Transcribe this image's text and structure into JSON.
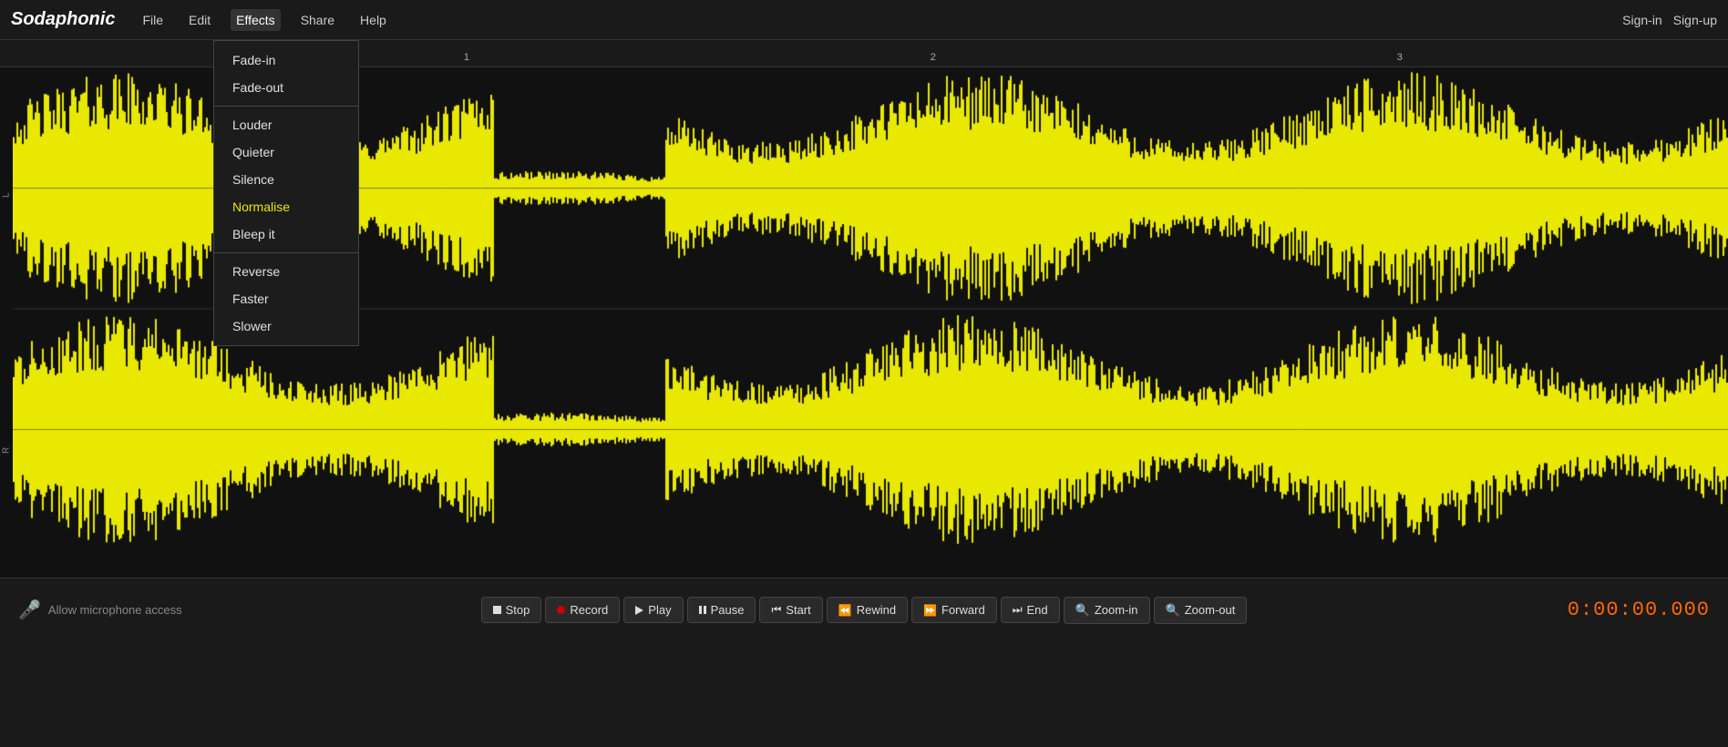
{
  "app": {
    "name": "Sodaphonic",
    "name_prefix": "Soda",
    "name_suffix": "phonic"
  },
  "header": {
    "nav": [
      {
        "id": "file",
        "label": "File"
      },
      {
        "id": "edit",
        "label": "Edit"
      },
      {
        "id": "effects",
        "label": "Effects",
        "active": true
      },
      {
        "id": "share",
        "label": "Share"
      },
      {
        "id": "help",
        "label": "Help"
      }
    ],
    "right": [
      {
        "id": "signin",
        "label": "Sign-in"
      },
      {
        "id": "signup",
        "label": "Sign-up"
      }
    ]
  },
  "effects_menu": {
    "items": [
      {
        "id": "fade-in",
        "label": "Fade-in",
        "group": 1
      },
      {
        "id": "fade-out",
        "label": "Fade-out",
        "group": 1
      },
      {
        "id": "louder",
        "label": "Louder",
        "group": 2
      },
      {
        "id": "quieter",
        "label": "Quieter",
        "group": 2
      },
      {
        "id": "silence",
        "label": "Silence",
        "group": 2
      },
      {
        "id": "normalise",
        "label": "Normalise",
        "group": 2,
        "highlighted": true
      },
      {
        "id": "bleep-it",
        "label": "Bleep it",
        "group": 2
      },
      {
        "id": "reverse",
        "label": "Reverse",
        "group": 3
      },
      {
        "id": "faster",
        "label": "Faster",
        "group": 3
      },
      {
        "id": "slower",
        "label": "Slower",
        "group": 3
      }
    ]
  },
  "timeline": {
    "marks": [
      {
        "label": "1",
        "position_pct": 27
      },
      {
        "label": "2",
        "position_pct": 54
      },
      {
        "label": "3",
        "position_pct": 81
      }
    ]
  },
  "channels": [
    {
      "label": "L"
    },
    {
      "label": "R"
    }
  ],
  "transport": {
    "mic_label": "Allow microphone access",
    "buttons": [
      {
        "id": "stop",
        "label": "Stop",
        "icon": "stop"
      },
      {
        "id": "record",
        "label": "Record",
        "icon": "record"
      },
      {
        "id": "play",
        "label": "Play",
        "icon": "play"
      },
      {
        "id": "pause",
        "label": "Pause",
        "icon": "pause"
      },
      {
        "id": "start",
        "label": "Start",
        "icon": "start"
      },
      {
        "id": "rewind",
        "label": "Rewind",
        "icon": "rewind"
      },
      {
        "id": "forward",
        "label": "Forward",
        "icon": "forward"
      },
      {
        "id": "end",
        "label": "End",
        "icon": "end"
      },
      {
        "id": "zoom-in",
        "label": "Zoom-in",
        "icon": "zoom-in"
      },
      {
        "id": "zoom-out",
        "label": "Zoom-out",
        "icon": "zoom-out"
      }
    ],
    "timer": "0:00:00.000"
  }
}
